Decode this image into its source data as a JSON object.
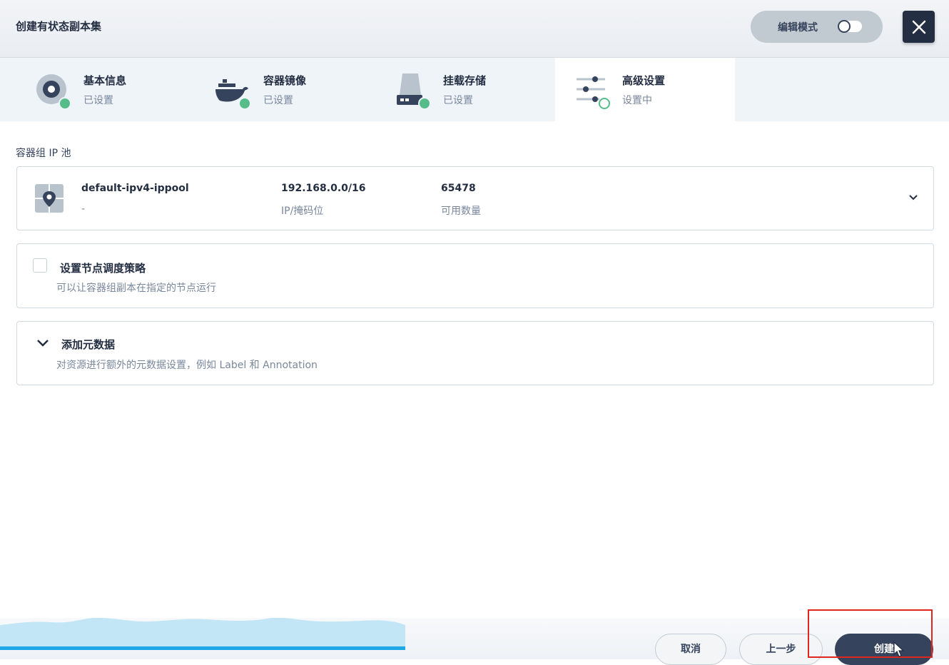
{
  "header": {
    "title": "创建有状态副本集",
    "edit_mode_label": "编辑模式",
    "close_icon": "close-icon"
  },
  "steps": [
    {
      "name": "基本信息",
      "status": "已设置",
      "icon": "disc-icon",
      "state": "done"
    },
    {
      "name": "容器镜像",
      "status": "已设置",
      "icon": "docker-icon",
      "state": "done"
    },
    {
      "name": "挂载存储",
      "status": "已设置",
      "icon": "storage-icon",
      "state": "done"
    },
    {
      "name": "高级设置",
      "status": "设置中",
      "icon": "sliders-icon",
      "state": "active"
    }
  ],
  "ip_pool": {
    "section_label": "容器组 IP 池",
    "name": "default-ipv4-ippool",
    "description": "-",
    "cidr": "192.168.0.0/16",
    "cidr_label": "IP/掩码位",
    "available": "65478",
    "available_label": "可用数量"
  },
  "node_schedule": {
    "title": "设置节点调度策略",
    "description": "可以让容器组副本在指定的节点运行",
    "checked": false
  },
  "metadata": {
    "title": "添加元数据",
    "description": "对资源进行额外的元数据设置，例如 Label 和 Annotation"
  },
  "footer": {
    "cancel_label": "取消",
    "prev_label": "上一步",
    "create_label": "创建"
  },
  "colors": {
    "done": "#55bc8a",
    "primary": "#36435c",
    "progress": "#1fa8e8",
    "highlight": "#e0271f"
  }
}
